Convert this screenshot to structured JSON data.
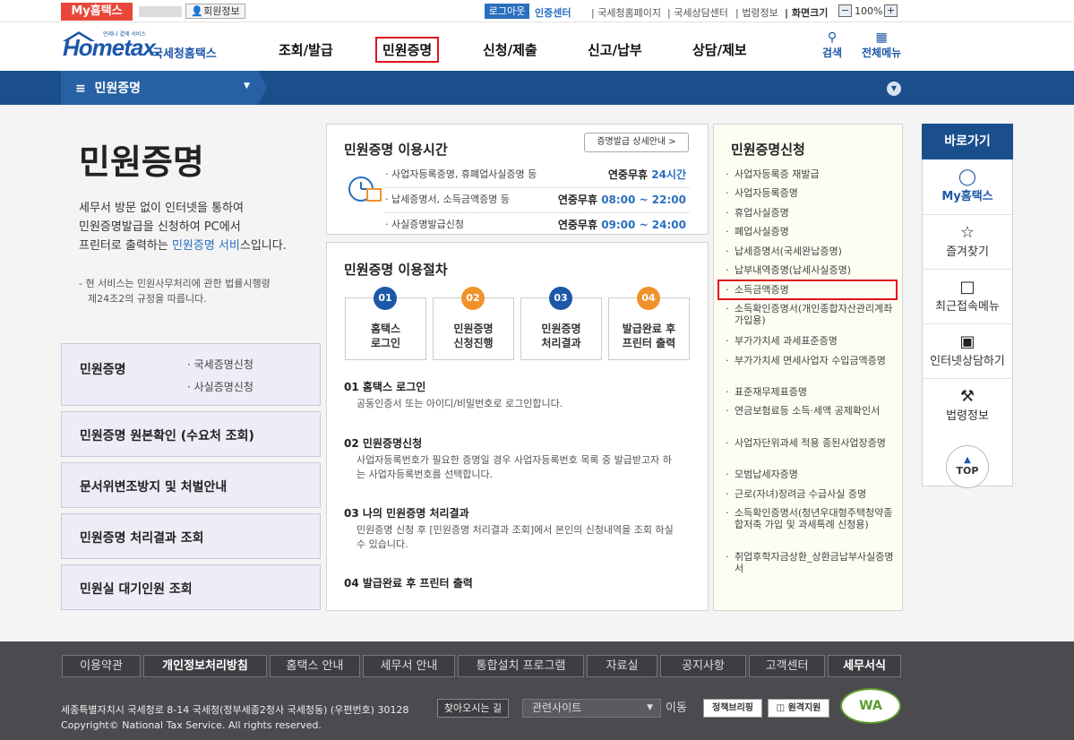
{
  "util": {
    "my_badge": "My홈택스",
    "member_info": "회원정보",
    "logout": "로그아웃",
    "cert_center": "인증센터",
    "links": [
      "국세청홈페이지",
      "국세상담센터",
      "법령정보",
      "화면크기"
    ],
    "zoom": "100%"
  },
  "header": {
    "logo_main": "Hometax.",
    "logo_small": "언제나 곁에 서비스",
    "logo_sub": "국세청홈택스",
    "gnb": [
      "조회/발급",
      "민원증명",
      "신청/제출",
      "신고/납부",
      "상담/제보"
    ],
    "search": "검색",
    "allmenu": "전체메뉴"
  },
  "bluebar": {
    "title": "민원증명"
  },
  "intro": {
    "title": "민원증명",
    "line1": "세무서 방문 없이 인터넷을 통하여",
    "line2": "민원증명발급을 신청하여 PC에서",
    "line3_pre": "프린터로 출력하는 ",
    "line3_link": "민원증명 서비",
    "line3_post": "스입니다.",
    "note1": "- 현 서비스는 민원사무처리에 관한 법률시행령",
    "note2": "제24조2의 규정을 따릅니다."
  },
  "left_menu": [
    {
      "label": "민원증명",
      "subs": [
        "· 국세증명신청",
        "· 사실증명신청"
      ]
    },
    {
      "label": "민원증명 원본확인 (수요처 조회)"
    },
    {
      "label": "문서위변조방지 및 처벌안내"
    },
    {
      "label": "민원증명 처리결과 조회"
    },
    {
      "label": "민원실 대기인원 조회"
    }
  ],
  "time": {
    "title": "민원증명 이용시간",
    "detail_btn": "증명발급 상세안내 >",
    "rows": [
      {
        "label": "· 사업자등록증명, 휴폐업사실증명 등",
        "pre": "연중무휴 ",
        "val": "24시간"
      },
      {
        "label": "· 납세증명서, 소득금액증명 등",
        "pre": "연중무휴 ",
        "val": "08:00 ~ 22:00"
      },
      {
        "label": "· 사실증명발급신청",
        "pre": "연중무휴 ",
        "val": "09:00 ~ 24:00"
      }
    ]
  },
  "process": {
    "title": "민원증명 이용절차",
    "steps": [
      {
        "num": "01",
        "l1": "홈택스",
        "l2": "로그인",
        "color": "#1d58a8"
      },
      {
        "num": "02",
        "l1": "민원증명",
        "l2": "신청진행",
        "color": "#f0922b"
      },
      {
        "num": "03",
        "l1": "민원증명",
        "l2": "처리결과",
        "color": "#1d58a8"
      },
      {
        "num": "04",
        "l1": "발급완료 후",
        "l2": "프린터 출력",
        "color": "#f0922b"
      }
    ],
    "desc": [
      {
        "title": "01 홈택스 로그인",
        "text": "공동인증서 또는 아이디/비밀번호로 로그인합니다."
      },
      {
        "title": "02 민원증명신청",
        "text": "사업자등록번호가 필요한 증명일 경우 사업자등록번호 목록 중 발급받고자 하는 사업자등록번호를 선택합니다."
      },
      {
        "title": "03 나의 민원증명 처리결과",
        "text": "민원증명 신청 후 [민원증명 처리결과 조회]에서 본인의 신청내역을 조회 하실 수 있습니다."
      },
      {
        "title": "04 발급완료 후 프린터 출력",
        "text": ""
      }
    ]
  },
  "apply": {
    "title": "민원증명신청",
    "items": [
      "사업자등록증 재발급",
      "사업자등록증명",
      "휴업사실증명",
      "폐업사실증명",
      "납세증명서(국세완납증명)",
      "납부내역증명(납세사실증명)",
      "소득금액증명",
      "소득확인증명서(개인종합자산관리계좌 가입용)",
      "부가가치세 과세표준증명",
      "부가가치세 면세사업자 수입금액증명",
      "표준재무제표증명",
      "연금보험료등 소득·세액 공제확인서",
      "사업자단위과세 적용 종된사업장증명",
      "모범납세자증명",
      "근로(자녀)장려금 수급사실 증명",
      "소득확인증명서(청년우대형주택청약종합저축 가입 및 과세특례 신청용)",
      "취업후학자금상환_상환금납부사실증명서"
    ]
  },
  "quick": {
    "title": "바로가기",
    "items": [
      "My홈택스",
      "즐겨찾기",
      "최근접속메뉴",
      "인터넷상담하기",
      "법령정보"
    ],
    "top": "TOP"
  },
  "footer": {
    "links": [
      "이용약관",
      "개인정보처리방침",
      "홈택스 안내",
      "세무서 안내",
      "통합설치 프로그램",
      "자료실",
      "공지사항",
      "고객센터",
      "세무서식"
    ],
    "address": "세종특별자치시 국세청로 8-14 국세청(정부세종2청사 국세청동) (우편번호) 30128",
    "findway": "찾아오시는 길",
    "related": "관련사이트",
    "go": "이동",
    "policy": "정책브리핑",
    "remote": "원격지원",
    "wa": "WA",
    "copyright": "Copyright© National Tax Service. All rights reserved."
  },
  "colors": {
    "navy": "#1b4f8c",
    "blue": "#2a6fbf",
    "red": "#e2131b",
    "orange": "#f0922b"
  }
}
